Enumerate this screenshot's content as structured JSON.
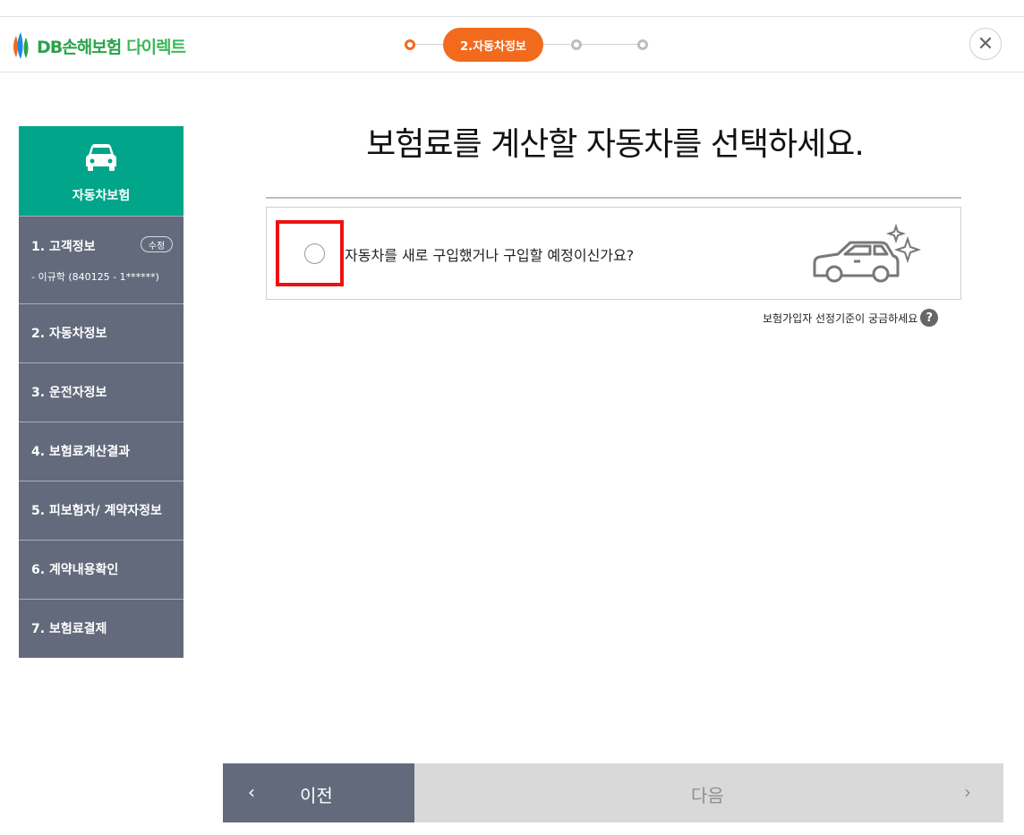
{
  "header": {
    "logo_text": "DB손해보험",
    "logo_sub": "다이렉트",
    "current_step_label": "2.자동차정보",
    "close_symbol": "✕"
  },
  "sidebar": {
    "head_label": "자동차보험",
    "items": [
      {
        "label": "1. 고객정보",
        "edit_label": "수정",
        "sub": "- 이규학 (840125 - 1******)"
      },
      {
        "label": "2. 자동차정보"
      },
      {
        "label": "3. 운전자정보"
      },
      {
        "label": "4. 보험료계산결과"
      },
      {
        "label": "5. 피보험자/ 계약자정보"
      },
      {
        "label": "6. 계약내용확인"
      },
      {
        "label": "7. 보험료결제"
      }
    ]
  },
  "main": {
    "title": "보험료를 계산할 자동차를 선택하세요.",
    "option_text": "자동차를 새로 구입했거나 구입할 예정이신가요?",
    "help_text": "보험가입자 선정기준이 궁금하세요",
    "help_icon": "?"
  },
  "footer": {
    "prev_label": "이전",
    "next_label": "다음",
    "prev_arrow": "‹",
    "next_arrow": "›"
  },
  "colors": {
    "accent_orange": "#f26b1d",
    "sidebar_teal": "#00a58a",
    "sidebar_slate": "#626a7b",
    "highlight_red": "#ee1111"
  }
}
